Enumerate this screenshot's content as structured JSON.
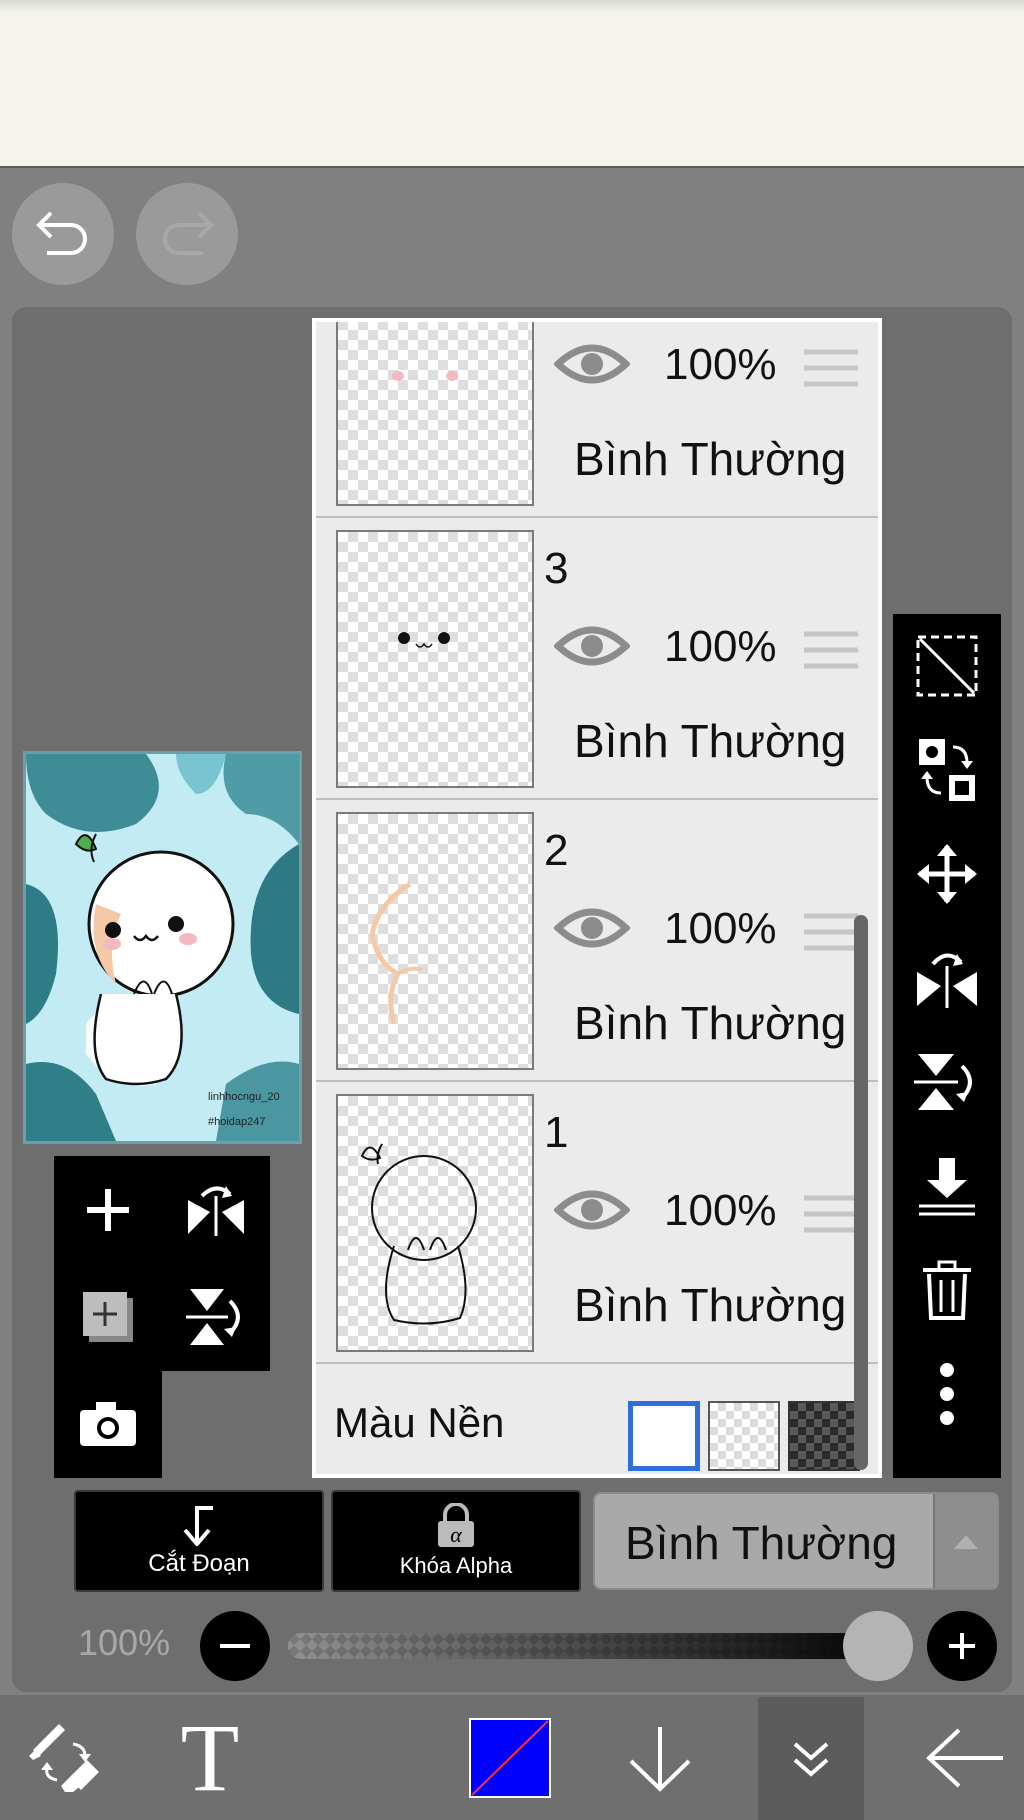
{
  "colors": {
    "panel_bg": "#6e6e6e",
    "list_bg": "#ebebeb",
    "accent_selected": "#2f6fdb",
    "primary_color": "#0000ff"
  },
  "top_buttons": [
    {
      "name": "undo-icon"
    },
    {
      "name": "redo-icon"
    }
  ],
  "layers": [
    {
      "number": "",
      "opacity": "100%",
      "blend": "Bình Thường"
    },
    {
      "number": "3",
      "opacity": "100%",
      "blend": "Bình Thường"
    },
    {
      "number": "2",
      "opacity": "100%",
      "blend": "Bình Thường"
    },
    {
      "number": "1",
      "opacity": "100%",
      "blend": "Bình Thường"
    }
  ],
  "background": {
    "label": "Màu Nền",
    "options": [
      "white",
      "transparent",
      "dark-checker"
    ],
    "selected": "white"
  },
  "preview": {
    "watermark_line1": "linhhocngu_20",
    "watermark_line2": "#hoidap247"
  },
  "right_toolbar": [
    "select-none-icon",
    "swap-layer-icon",
    "move-icon",
    "flip-horizontal-icon",
    "flip-vertical-rotate-icon",
    "merge-down-icon",
    "trash-icon",
    "more-icon"
  ],
  "left_tools": [
    "add-layer-icon",
    "flip-layer-horizontal-icon",
    "add-image-layer-icon",
    "flip-layer-vertical-icon",
    "camera-icon"
  ],
  "bottom_buttons": {
    "clipping_label": "Cắt Đoạn",
    "alpha_lock_label": "Khóa Alpha",
    "alpha_symbol": "α",
    "blend_mode": "Bình Thường"
  },
  "opacity_slider": {
    "label": "100%",
    "value": 1.0
  },
  "bottom_toolbar": [
    "brush-eraser-icon",
    "text-icon",
    "color-swatch",
    "download-arrow-icon",
    "collapse-icon",
    "back-arrow-icon"
  ],
  "text_tool_glyph": "T"
}
